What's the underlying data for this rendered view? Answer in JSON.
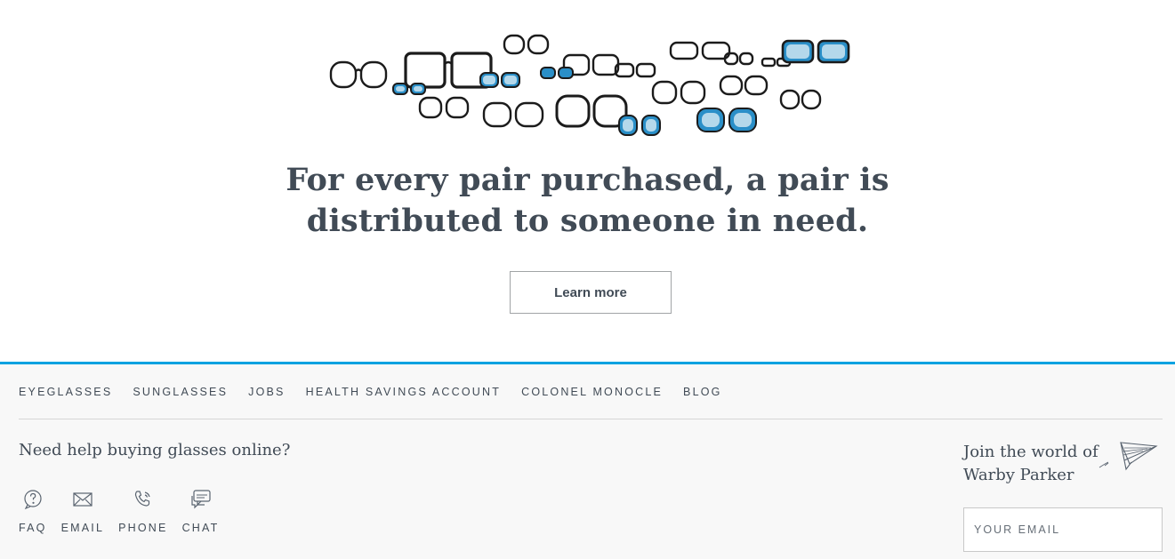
{
  "hero": {
    "headline_line1": "For every pair purchased, a pair is",
    "headline_line2": "distributed to someone in need.",
    "learn_more_label": "Learn more"
  },
  "footer": {
    "nav": [
      "EYEGLASSES",
      "SUNGLASSES",
      "JOBS",
      "HEALTH SAVINGS ACCOUNT",
      "COLONEL MONOCLE",
      "BLOG"
    ],
    "help_title": "Need help buying glasses online?",
    "help_links": [
      {
        "label": "FAQ",
        "icon": "question-bubble-icon"
      },
      {
        "label": "EMAIL",
        "icon": "envelope-icon"
      },
      {
        "label": "PHONE",
        "icon": "phone-icon"
      },
      {
        "label": "CHAT",
        "icon": "chat-bubble-icon"
      }
    ],
    "join_line1": "Join the world of",
    "join_line2": "Warby Parker",
    "email_placeholder": "YOUR EMAIL"
  },
  "colors": {
    "accent_blue": "#00a2e1",
    "text": "#414b56",
    "footer_bg": "#f8f8f8"
  }
}
